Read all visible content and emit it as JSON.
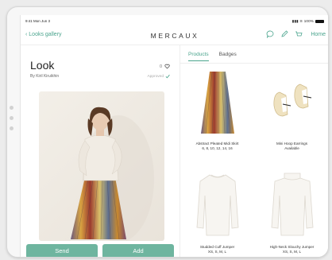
{
  "status": {
    "time": "9:41",
    "date": "Mon Jun 3",
    "battery": "100%"
  },
  "nav": {
    "back_label": "Looks gallery",
    "brand": "MERCAUX",
    "home_label": "Home",
    "icons": [
      "chat-icon",
      "edit-icon",
      "cart-icon"
    ]
  },
  "look": {
    "title": "Look",
    "author": "By Kiril Kiruikhin",
    "likes": "0",
    "status": "Approved"
  },
  "actions": {
    "send": "Send",
    "add": "Add"
  },
  "tabs": [
    {
      "label": "Products",
      "active": true
    },
    {
      "label": "Badges",
      "active": false
    }
  ],
  "products": [
    {
      "name": "Abstract Pleated Midi Skirt",
      "sizes": "6, 8, 10, 12, 14, 16",
      "image": "skirt"
    },
    {
      "name": "Mini Hoop Earrings",
      "sizes": "Available",
      "image": "earrings"
    },
    {
      "name": "Studded Cuff Jumper",
      "sizes": "XS, S, M, L",
      "image": "jumper"
    },
    {
      "name": "High-Neck Slouchy Jumper",
      "sizes": "XS, S, M, L",
      "image": "jumper"
    }
  ],
  "colors": {
    "accent": "#4aa48d",
    "button": "#6eb59f"
  }
}
